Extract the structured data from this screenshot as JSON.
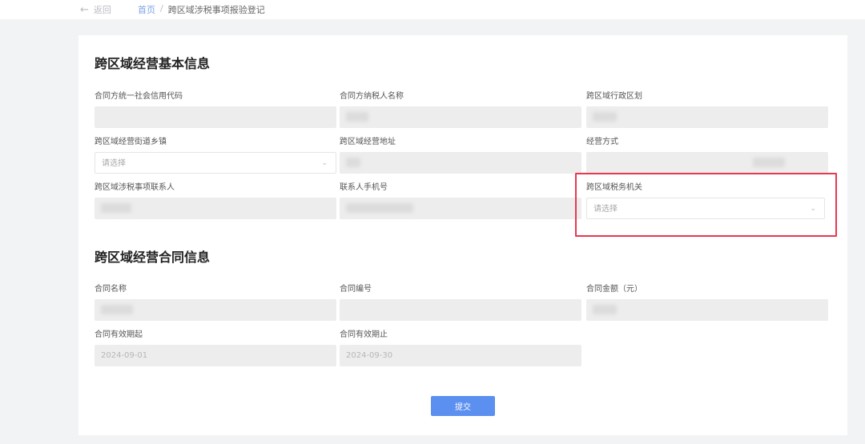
{
  "header": {
    "back_label": "返回",
    "breadcrumb": {
      "home": "首页",
      "separator": "/",
      "current": "跨区域涉税事项报验登记"
    }
  },
  "section1": {
    "title": "跨区域经营基本信息",
    "fields": [
      {
        "label": "合同方统一社会信用代码",
        "value": "",
        "placeholder": ""
      },
      {
        "label": "合同方纳税人名称",
        "value": "",
        "placeholder": ""
      },
      {
        "label": "跨区域行政区划",
        "value": "",
        "placeholder": ""
      },
      {
        "label": "跨区域经营街道乡镇",
        "value": "",
        "placeholder": "请选择"
      },
      {
        "label": "跨区域经营地址",
        "value": "",
        "placeholder": ""
      },
      {
        "label": "经营方式",
        "value": "",
        "placeholder": ""
      },
      {
        "label": "跨区域涉税事项联系人",
        "value": "",
        "placeholder": ""
      },
      {
        "label": "联系人手机号",
        "value": "",
        "placeholder": ""
      },
      {
        "label": "跨区域税务机关",
        "value": "",
        "placeholder": "请选择"
      }
    ]
  },
  "section2": {
    "title": "跨区域经营合同信息",
    "fields": [
      {
        "label": "合同名称",
        "value": ""
      },
      {
        "label": "合同编号",
        "value": ""
      },
      {
        "label": "合同金额（元）",
        "value": ""
      },
      {
        "label": "合同有效期起",
        "value": "2024-09-01"
      },
      {
        "label": "合同有效期止",
        "value": "2024-09-30"
      }
    ]
  },
  "submit_label": "提交",
  "colors": {
    "accent": "#5b8ff0",
    "highlight": "#e8384f"
  }
}
